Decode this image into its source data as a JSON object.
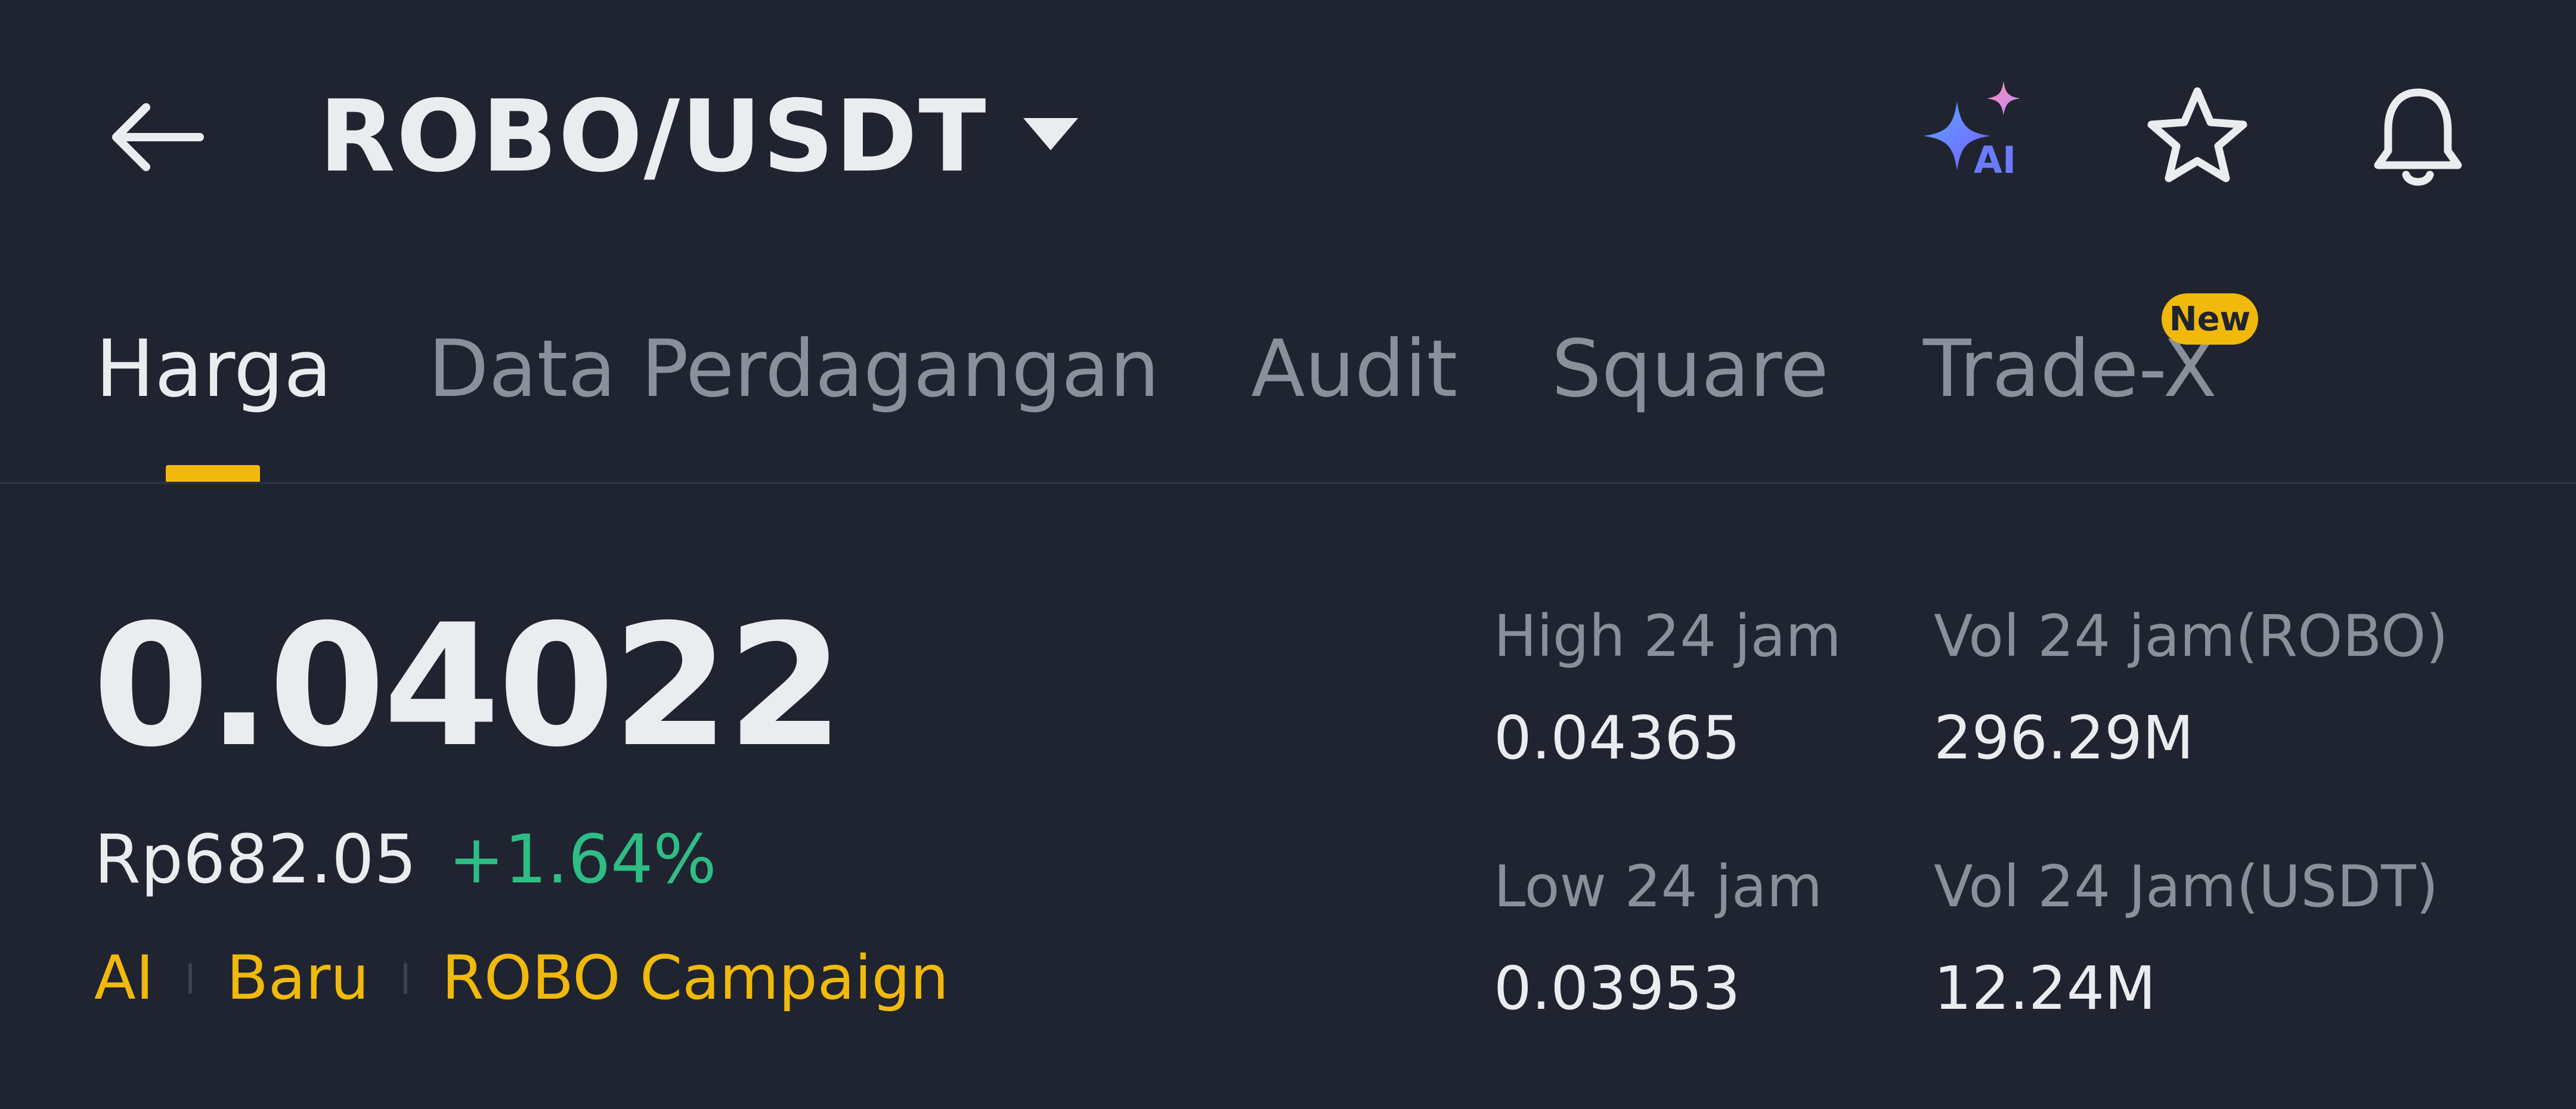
{
  "header": {
    "pair": "ROBO/USDT",
    "icons": {
      "back": "arrow-left-icon",
      "dropdown": "caret-down-icon",
      "ai": "ai-sparkle-icon",
      "favorite": "star-icon",
      "alerts": "bell-icon"
    },
    "ai_badge": "AI"
  },
  "tabs": [
    {
      "label": "Harga",
      "active": true
    },
    {
      "label": "Data Perdagangan",
      "active": false
    },
    {
      "label": "Audit",
      "active": false
    },
    {
      "label": "Square",
      "active": false
    },
    {
      "label": "Trade-X",
      "active": false,
      "badge": "New"
    }
  ],
  "price": {
    "last": "0.04022",
    "idr": "Rp682.05",
    "change": "+1.64%"
  },
  "tags": [
    "AI",
    "Baru",
    "ROBO Campaign"
  ],
  "stats": {
    "high_label": "High 24 jam",
    "high_value": "0.04365",
    "vol_base_label": "Vol 24 jam(ROBO)",
    "vol_base_value": "296.29M",
    "low_label": "Low 24 jam",
    "low_value": "0.03953",
    "vol_quote_label": "Vol 24 Jam(USDT)",
    "vol_quote_value": "12.24M"
  },
  "colors": {
    "background": "#1F2430",
    "accent": "#F0B90B",
    "positive": "#2EBD85",
    "muted_text": "#8A909B",
    "primary_text": "#EAECEF"
  }
}
